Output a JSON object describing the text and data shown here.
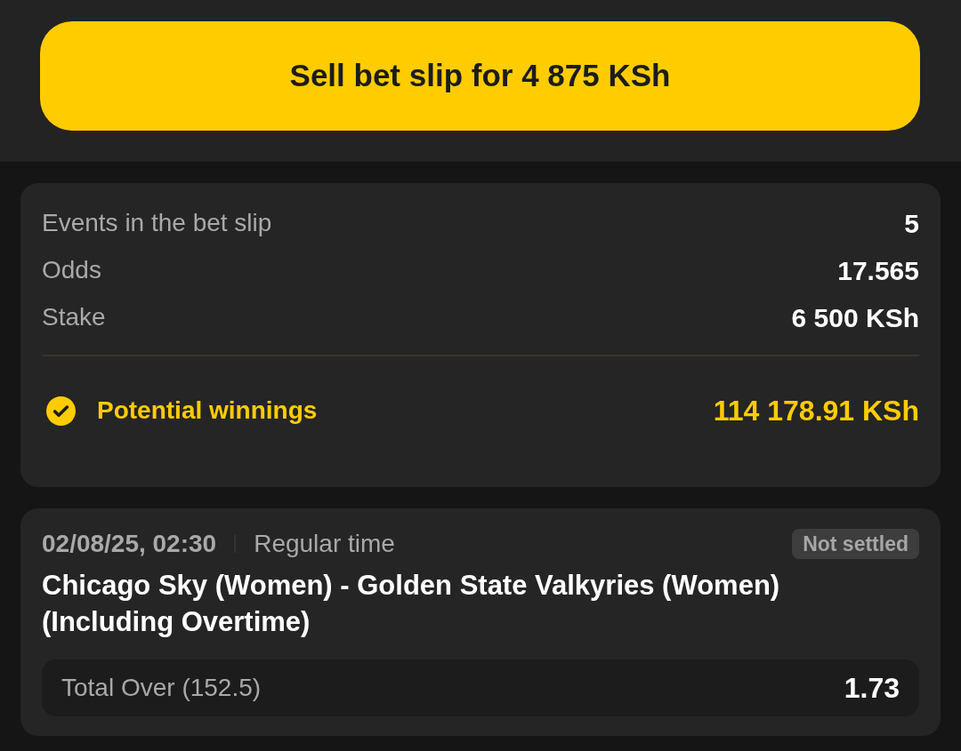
{
  "sell_button": {
    "label": "Sell bet slip for 4 875 KSh"
  },
  "summary": {
    "rows": [
      {
        "label": "Events in the bet slip",
        "value": "5"
      },
      {
        "label": "Odds",
        "value": "17.565"
      },
      {
        "label": "Stake",
        "value": "6 500 KSh"
      }
    ],
    "potential_winnings": {
      "label": "Potential winnings",
      "value": "114 178.91 KSh",
      "checked": true
    }
  },
  "events": [
    {
      "datetime": "02/08/25, 02:30",
      "period": "Regular time",
      "status": "Not settled",
      "title": "Chicago Sky (Women) - Golden State Valkyries (Women) (Including Overtime)",
      "market": "Total Over (152.5)",
      "odds": "1.73"
    }
  ]
}
